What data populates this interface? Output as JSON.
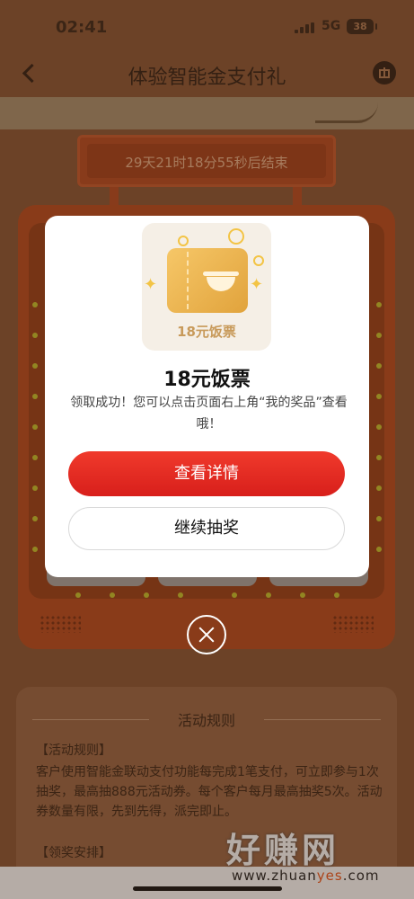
{
  "status_bar": {
    "time": "02:41",
    "network": "5G",
    "battery": "38"
  },
  "nav": {
    "title": "体验智能金支付礼",
    "back_icon": "chevron-left-icon",
    "gift_icon": "gift-icon"
  },
  "countdown": {
    "text": "29天21时18分55秒后结束"
  },
  "rules": {
    "title": "活动规则",
    "section1_title": "【活动规则】",
    "section1_body": "客户使用智能金联动支付功能每完成1笔支付，可立即参与1次抽奖，最高抽888元活动券。每个客户每月最高抽奖5次。活动券数量有限，先到先得，派完即止。",
    "section2_title": "【领奖安排】"
  },
  "modal": {
    "card_label": "18元饭票",
    "prize_name": "18元饭票",
    "description": "领取成功！您可以点击页面右上角“我的奖品”查看哦！",
    "primary_button": "查看详情",
    "secondary_button": "继续抽奖",
    "close_icon": "close-circle-icon"
  },
  "watermark": {
    "main": "好赚网",
    "url_prefix": "www.zhuan",
    "url_highlight": "yes",
    "url_suffix": ".com"
  },
  "colors": {
    "primary_red": "#e8281f",
    "page_brown": "#8a5532",
    "gold": "#e1a33c"
  }
}
